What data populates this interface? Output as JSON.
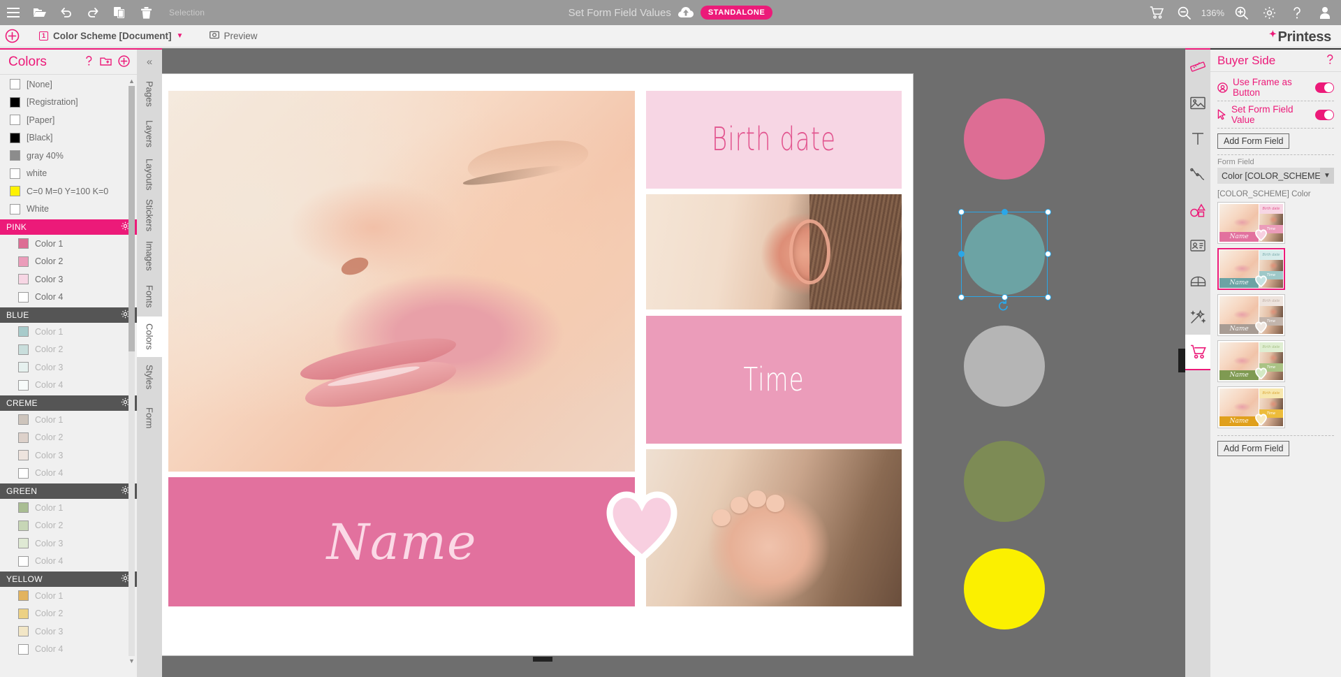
{
  "topbar": {
    "icons": [
      "menu-icon",
      "folder-open-icon",
      "undo-icon",
      "redo-icon",
      "copy-icon",
      "trash-icon"
    ],
    "selection_label": "Selection",
    "center_title": "Set Form Field Values",
    "cloud_icon": "cloud-upload-icon",
    "badge": "STANDALONE",
    "right_icons": [
      "cart-icon",
      "zoom-out-icon",
      "zoom-in-icon",
      "gear-icon",
      "help-icon",
      "user-icon"
    ],
    "zoom_level": "136%"
  },
  "tabbar": {
    "add_label": "+",
    "doc_number": "1",
    "doc_tab": "Color Scheme [Document]",
    "preview_tab": "Preview",
    "brand": "Printess"
  },
  "left_panel": {
    "title": "Colors",
    "head_icons": [
      "help-icon",
      "new-folder-icon",
      "add-color-icon"
    ],
    "base_swatches": [
      {
        "label": "[None]",
        "color": "#ffffff"
      },
      {
        "label": "[Registration]",
        "color": "#000000"
      },
      {
        "label": "[Paper]",
        "color": "#ffffff"
      },
      {
        "label": "[Black]",
        "color": "#000000"
      },
      {
        "label": "gray 40%",
        "color": "#8c8c8c"
      },
      {
        "label": "white",
        "color": "#ffffff"
      },
      {
        "label": "C=0 M=0 Y=100 K=0",
        "color": "#fff200"
      },
      {
        "label": "White",
        "color": "#ffffff"
      }
    ],
    "groups": [
      {
        "name": "PINK",
        "active": true,
        "gear": "gear-icon",
        "colors": [
          {
            "label": "Color 1",
            "color": "#dd6d94"
          },
          {
            "label": "Color 2",
            "color": "#eb9cba"
          },
          {
            "label": "Color 3",
            "color": "#f7d6e4"
          },
          {
            "label": "Color 4",
            "color": "#ffffff"
          }
        ]
      },
      {
        "name": "BLUE",
        "active": false,
        "gear": "gear-icon",
        "colors": [
          {
            "label": "Color 1",
            "color": "#a8cbcb"
          },
          {
            "label": "Color 2",
            "color": "#c9dedc"
          },
          {
            "label": "Color 3",
            "color": "#e6f1ef"
          },
          {
            "label": "Color 4",
            "color": "#f7fbfa"
          }
        ]
      },
      {
        "name": "CREME",
        "active": false,
        "gear": "gear-icon",
        "colors": [
          {
            "label": "Color 1",
            "color": "#cdc4bc"
          },
          {
            "label": "Color 2",
            "color": "#ddd1ca"
          },
          {
            "label": "Color 3",
            "color": "#eee4de"
          },
          {
            "label": "Color 4",
            "color": "#ffffff"
          }
        ]
      },
      {
        "name": "GREEN",
        "active": false,
        "gear": "gear-icon",
        "colors": [
          {
            "label": "Color 1",
            "color": "#a9bd92"
          },
          {
            "label": "Color 2",
            "color": "#c7d6b6"
          },
          {
            "label": "Color 3",
            "color": "#dfe9d4"
          },
          {
            "label": "Color 4",
            "color": "#ffffff"
          }
        ]
      },
      {
        "name": "YELLOW",
        "active": false,
        "gear": "gear-icon",
        "colors": [
          {
            "label": "Color 1",
            "color": "#e2b35f"
          },
          {
            "label": "Color 2",
            "color": "#ecd184"
          },
          {
            "label": "Color 3",
            "color": "#f2e6c6"
          },
          {
            "label": "Color 4",
            "color": "#ffffff"
          }
        ]
      }
    ]
  },
  "vertical_tabs": {
    "collapse_icon": "chevron-double-left-icon",
    "items": [
      "Pages",
      "Layers",
      "Layouts",
      "Stickers",
      "Images",
      "Fonts",
      "Colors",
      "Styles",
      "Form"
    ],
    "active": "Colors"
  },
  "canvas": {
    "page": {
      "blocks": {
        "birth_date": {
          "text": "Birth date",
          "bg": "#f7d6e4",
          "color": "#e2558f"
        },
        "time": {
          "text": "Time",
          "bg": "#eb9cba",
          "color": "#ffffff"
        },
        "name": {
          "text": "Name",
          "bg": "#e2719e",
          "color": "#fbd9e6"
        },
        "heart": {
          "icon": "heart-icon",
          "fill": "#f8cfe0",
          "stroke": "#ffffff"
        },
        "photo_face": "baby-face-photo",
        "photo_ear": "baby-ear-photo",
        "photo_feet": "baby-feet-photo"
      }
    },
    "circles": [
      {
        "name": "circle-pink",
        "color": "#dd6d94",
        "selected": false
      },
      {
        "name": "circle-teal",
        "color": "#6ca3a4",
        "selected": true
      },
      {
        "name": "circle-gray",
        "color": "#b5b5b5",
        "selected": false
      },
      {
        "name": "circle-olive",
        "color": "#7d8b55",
        "selected": false
      },
      {
        "name": "circle-yellow",
        "color": "#fbf000",
        "selected": false
      }
    ],
    "selection_color": "#2aa7e8",
    "rotate_icon": "rotate-icon"
  },
  "right_icon_strip": {
    "items": [
      {
        "name": "ruler-icon",
        "accent": true,
        "active": false
      },
      {
        "name": "image-icon",
        "accent": false,
        "active": false
      },
      {
        "name": "text-icon",
        "accent": false,
        "active": false
      },
      {
        "name": "path-icon",
        "accent": false,
        "active": false
      },
      {
        "name": "shapes-icon",
        "accent": true,
        "active": false
      },
      {
        "name": "id-card-icon",
        "accent": false,
        "active": false
      },
      {
        "name": "arch-icon",
        "accent": false,
        "active": false
      },
      {
        "name": "magic-wand-icon",
        "accent": false,
        "active": false
      },
      {
        "name": "cart-icon",
        "accent": true,
        "active": true
      }
    ]
  },
  "right_panel": {
    "title": "Buyer Side",
    "help_icon": "help-icon",
    "rows": [
      {
        "icon": "target-icon",
        "label": "Use Frame as Button",
        "toggle": true
      },
      {
        "icon": "cursor-icon",
        "label": "Set Form Field Value",
        "toggle": true
      }
    ],
    "add_form_field_top": "Add Form Field",
    "form_field_label": "Form Field",
    "form_field_value": "Color [COLOR_SCHEME]",
    "scheme_caption": "[COLOR_SCHEME] Color",
    "add_form_field_bottom": "Add Form Field",
    "schemes": [
      {
        "name": "pink-scheme",
        "selected": false,
        "name_bg": "#e2719e",
        "tile1": "#f7d6e4",
        "tile3": "#eb9cba",
        "heart": "#f8cfe0",
        "label": "Name"
      },
      {
        "name": "blue-scheme",
        "selected": true,
        "name_bg": "#6ca3a4",
        "tile1": "#d8eceb",
        "tile3": "#9ec8c8",
        "heart": "#c6e3e2",
        "label": "Name"
      },
      {
        "name": "creme-scheme",
        "selected": false,
        "name_bg": "#a89c94",
        "tile1": "#eee4de",
        "tile3": "#c2b4ab",
        "heart": "#efe7e1",
        "label": "Name"
      },
      {
        "name": "green-scheme",
        "selected": false,
        "name_bg": "#7f9a52",
        "tile1": "#dfeed2",
        "tile3": "#aac385",
        "heart": "#d4e9c4",
        "label": "Name"
      },
      {
        "name": "yellow-scheme",
        "selected": false,
        "name_bg": "#e0a01c",
        "tile1": "#f7e7ae",
        "tile3": "#edbc3a",
        "heart": "#f8eac1",
        "label": "Name"
      }
    ],
    "scheme_tile_labels": {
      "top": "Birth date",
      "mid": "Time"
    }
  }
}
